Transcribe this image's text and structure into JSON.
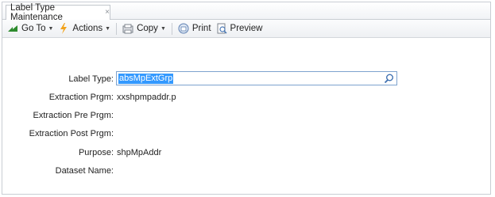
{
  "tab": {
    "label": "Label Type Maintenance",
    "close": "×"
  },
  "toolbar": {
    "goto_label": "Go To",
    "actions_label": "Actions",
    "copy_label": "Copy",
    "print_label": "Print",
    "preview_label": "Preview",
    "caret": "▼"
  },
  "form": {
    "label_type": {
      "label": "Label Type:",
      "value": "absMpExtGrp"
    },
    "extraction_prgm": {
      "label": "Extraction Prgm:",
      "value": "xxshpmpaddr.p"
    },
    "extraction_pre_prgm": {
      "label": "Extraction Pre Prgm:",
      "value": ""
    },
    "extraction_post_prgm": {
      "label": "Extraction Post Prgm:",
      "value": ""
    },
    "purpose": {
      "label": "Purpose:",
      "value": "shpMpAddr"
    },
    "dataset_name": {
      "label": "Dataset Name:",
      "value": ""
    }
  },
  "colors": {
    "selection": "#3399ff",
    "input_border": "#7da2ce",
    "goto_icon": "#2e8b2e",
    "actions_icon": "#f2a31b"
  },
  "icons": {
    "goto": "arrow-right-icon",
    "actions": "lightning-icon",
    "copy": "copy-icon",
    "print": "printer-icon",
    "preview": "preview-icon",
    "search": "search-icon"
  }
}
